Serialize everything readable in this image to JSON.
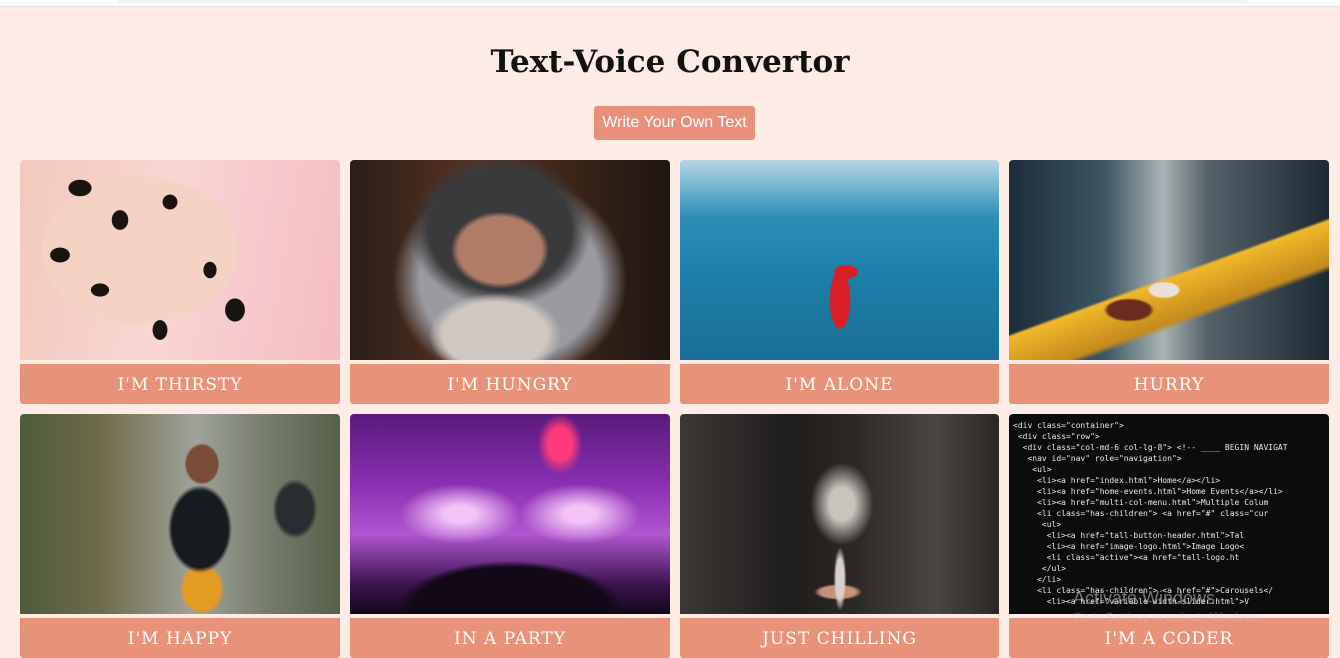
{
  "header": {
    "title": "Text-Voice Convertor",
    "write_button_label": "Write Your Own Text"
  },
  "cards": [
    {
      "label": "I'm thirsty",
      "image": "dalmatian-dog-drinking"
    },
    {
      "label": "I'm hungry",
      "image": "old-man-hood"
    },
    {
      "label": "I'm alone",
      "image": "person-red-jacket-sea"
    },
    {
      "label": "Hurry",
      "image": "city-street-motion-blur"
    },
    {
      "label": "I'm happy",
      "image": "boy-on-bicycle"
    },
    {
      "label": "In a party",
      "image": "concert-crowd-fireworks"
    },
    {
      "label": "Just chilling",
      "image": "wine-glass"
    },
    {
      "label": "I'm a coder",
      "image": "code-editor-screen"
    }
  ],
  "colors": {
    "background": "#fdebe6",
    "accent": "#e8927a",
    "label_text": "#ffffff"
  },
  "code_image_lines": [
    "<div class=\"container\">",
    " <div class=\"row\">",
    "  <div class=\"col-md-6 col-lg-8\"> <!-- ____ BEGIN NAVIGAT",
    "   <nav id=\"nav\" role=\"navigation\">",
    "    <ul>",
    "     <li><a href=\"index.html\">Home</a></li>",
    "     <li><a href=\"home-events.html\">Home Events</a></li>",
    "     <li><a href=\"multi-col-menu.html\">Multiple Colum",
    "     <li class=\"has-children\"> <a href=\"#\" class=\"cur",
    "      <ul>",
    "       <li><a href=\"tall-button-header.html\">Tal",
    "       <li><a href=\"image-logo.html\">Image Logo<",
    "       <li class=\"active\"><a href=\"tall-logo.ht",
    "      </ul>",
    "     </li>",
    "     <li class=\"has-children\"> <a href=\"#\">Carousels</",
    "       <li><a href=\"variable-width-slider.html\">V"
  ],
  "watermark": {
    "title": "Activate Windows",
    "subtitle": "Go to Settings to activate Windows."
  }
}
